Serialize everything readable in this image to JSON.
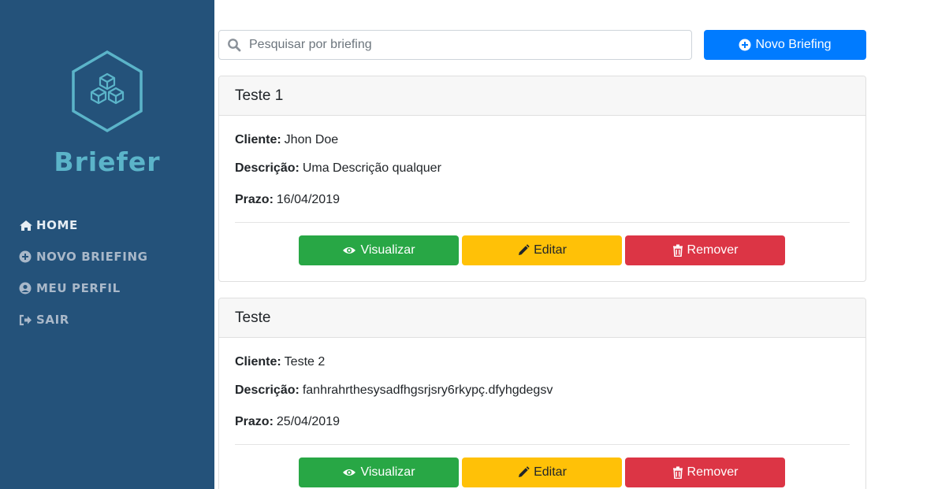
{
  "brand": {
    "name": "Briefer"
  },
  "nav": {
    "items": [
      {
        "label": "HOME",
        "icon": "home-icon"
      },
      {
        "label": "NOVO BRIEFING",
        "icon": "plus-circle-icon"
      },
      {
        "label": "MEU PERFIL",
        "icon": "user-circle-icon"
      },
      {
        "label": "SAIR",
        "icon": "sign-out-icon"
      }
    ]
  },
  "search": {
    "placeholder": "Pesquisar por briefing",
    "value": ""
  },
  "new_button": {
    "label": "Novo Briefing"
  },
  "labels": {
    "cliente": "Cliente:",
    "descricao": "Descrição:",
    "prazo": "Prazo:"
  },
  "actions": {
    "view": "Visualizar",
    "edit": "Editar",
    "remove": "Remover"
  },
  "briefings": [
    {
      "title": "Teste 1",
      "cliente": "Jhon Doe",
      "descricao": "Uma Descrição qualquer",
      "prazo": "16/04/2019"
    },
    {
      "title": "Teste",
      "cliente": "Teste 2",
      "descricao": "fanhrahrthesysadfhgsrjsry6rkypç.dfyhgdegsv",
      "prazo": "25/04/2019"
    }
  ],
  "colors": {
    "sidebar": "#24527a",
    "brand": "#5bb4c9",
    "primary": "#007bff",
    "success": "#28a745",
    "warning": "#ffc107",
    "danger": "#dc3545"
  }
}
